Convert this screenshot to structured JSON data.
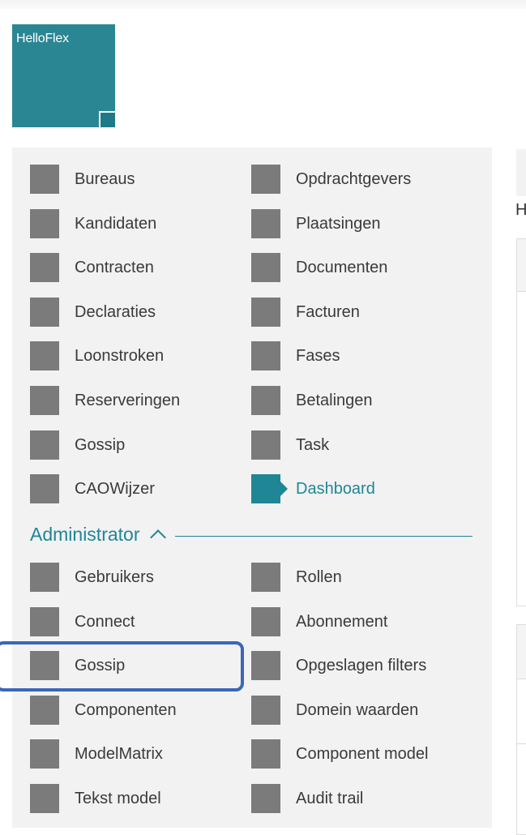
{
  "app": {
    "logo_text": "HelloFlex"
  },
  "menu": {
    "items": [
      {
        "label": "Bureaus"
      },
      {
        "label": "Opdrachtgevers"
      },
      {
        "label": "Kandidaten"
      },
      {
        "label": "Plaatsingen"
      },
      {
        "label": "Contracten"
      },
      {
        "label": "Documenten"
      },
      {
        "label": "Declaraties"
      },
      {
        "label": "Facturen"
      },
      {
        "label": "Loonstroken"
      },
      {
        "label": "Fases"
      },
      {
        "label": "Reserveringen"
      },
      {
        "label": "Betalingen"
      },
      {
        "label": "Gossip"
      },
      {
        "label": "Task"
      },
      {
        "label": "CAOWijzer"
      },
      {
        "label": "Dashboard",
        "active": true
      }
    ]
  },
  "admin": {
    "section_label": "Administrator",
    "items": [
      {
        "label": "Gebruikers"
      },
      {
        "label": "Rollen"
      },
      {
        "label": "Connect"
      },
      {
        "label": "Abonnement"
      },
      {
        "label": "Gossip",
        "highlighted": true
      },
      {
        "label": "Opgeslagen filters"
      },
      {
        "label": "Componenten"
      },
      {
        "label": "Domein waarden"
      },
      {
        "label": "ModelMatrix"
      },
      {
        "label": "Component model"
      },
      {
        "label": "Tekst model"
      },
      {
        "label": "Audit trail"
      }
    ]
  },
  "right_panel": {
    "heading_fragment": "H"
  },
  "colors": {
    "brand": "#2a8693",
    "accent": "#1f8696",
    "icon_gray": "#7b7b7b",
    "highlight_border": "#3a67b8",
    "panel_bg": "#f2f2f2"
  }
}
